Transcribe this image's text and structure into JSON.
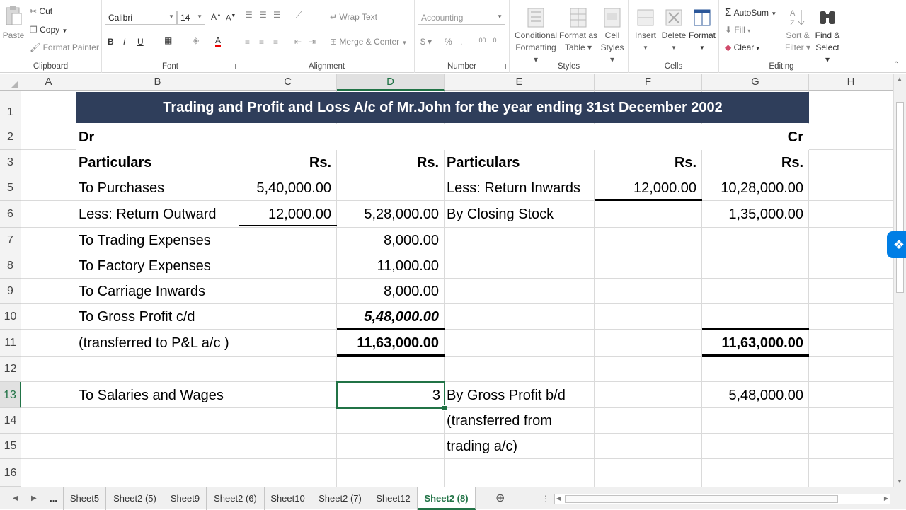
{
  "ribbon": {
    "clipboard": {
      "paste": "Paste",
      "cut": "Cut",
      "copy": "Copy",
      "format_painter": "Format Painter",
      "label": "Clipboard"
    },
    "font": {
      "name": "Calibri",
      "size": "14",
      "bold": "B",
      "italic": "I",
      "underline": "U",
      "label": "Font"
    },
    "alignment": {
      "wrap_text": "Wrap Text",
      "merge_center": "Merge & Center",
      "label": "Alignment"
    },
    "number": {
      "format": "Accounting",
      "percent": "%",
      "comma": ",",
      "label": "Number"
    },
    "styles": {
      "conditional": "Conditional",
      "formatting": "Formatting",
      "format_as": "Format as",
      "table": "Table",
      "cell": "Cell",
      "styles": "Styles",
      "label": "Styles"
    },
    "cells": {
      "insert": "Insert",
      "delete": "Delete",
      "format": "Format",
      "label": "Cells"
    },
    "editing": {
      "autosum": "AutoSum",
      "fill": "Fill",
      "clear": "Clear",
      "sort": "Sort &",
      "filter": "Filter",
      "find": "Find &",
      "select": "Select",
      "label": "Editing"
    }
  },
  "columns": [
    "A",
    "B",
    "C",
    "D",
    "E",
    "F",
    "G",
    "H"
  ],
  "rows": [
    "1",
    "2",
    "3",
    "5",
    "6",
    "7",
    "8",
    "9",
    "10",
    "11",
    "12",
    "13",
    "14",
    "15",
    "16"
  ],
  "sheet": {
    "title": "Trading and Profit and Loss A/c of Mr.John for the year ending 31st December 2002",
    "dr": "Dr",
    "cr": "Cr",
    "hdr_particulars": "Particulars",
    "hdr_rs": "Rs.",
    "left": [
      {
        "label": "To Purchases",
        "c": "5,40,000.00",
        "d": ""
      },
      {
        "label": "Less: Return Outward",
        "c": "12,000.00",
        "d": "5,28,000.00"
      },
      {
        "label": "To Trading Expenses",
        "c": "",
        "d": "8,000.00"
      },
      {
        "label": "To Factory Expenses",
        "c": "",
        "d": "11,000.00"
      },
      {
        "label": "To Carriage Inwards",
        "c": "",
        "d": "8,000.00"
      },
      {
        "label": "To Gross Profit c/d",
        "c": "",
        "d": "5,48,000.00"
      },
      {
        "label": "(transferred to P&L a/c )",
        "c": "",
        "d": "11,63,000.00"
      }
    ],
    "right": [
      {
        "label": "Less: Return Inwards",
        "f": "12,000.00",
        "g": "10,28,000.00"
      },
      {
        "label": "By Closing Stock",
        "f": "",
        "g": "1,35,000.00"
      }
    ],
    "total_g": "11,63,000.00",
    "row13_b": "To Salaries and Wages",
    "row13_d": "3",
    "row13_e": "By Gross Profit b/d",
    "row13_g": "5,48,000.00",
    "row14_e": "(transferred from",
    "row15_e": "trading a/c)"
  },
  "tabs": [
    "...",
    "Sheet5",
    "Sheet2 (5)",
    "Sheet9",
    "Sheet2 (6)",
    "Sheet10",
    "Sheet2 (7)",
    "Sheet12",
    "Sheet2 (8)"
  ],
  "active_tab": "Sheet2 (8)",
  "colors": {
    "title_bg": "#2f3e5b",
    "accent": "#217346"
  }
}
